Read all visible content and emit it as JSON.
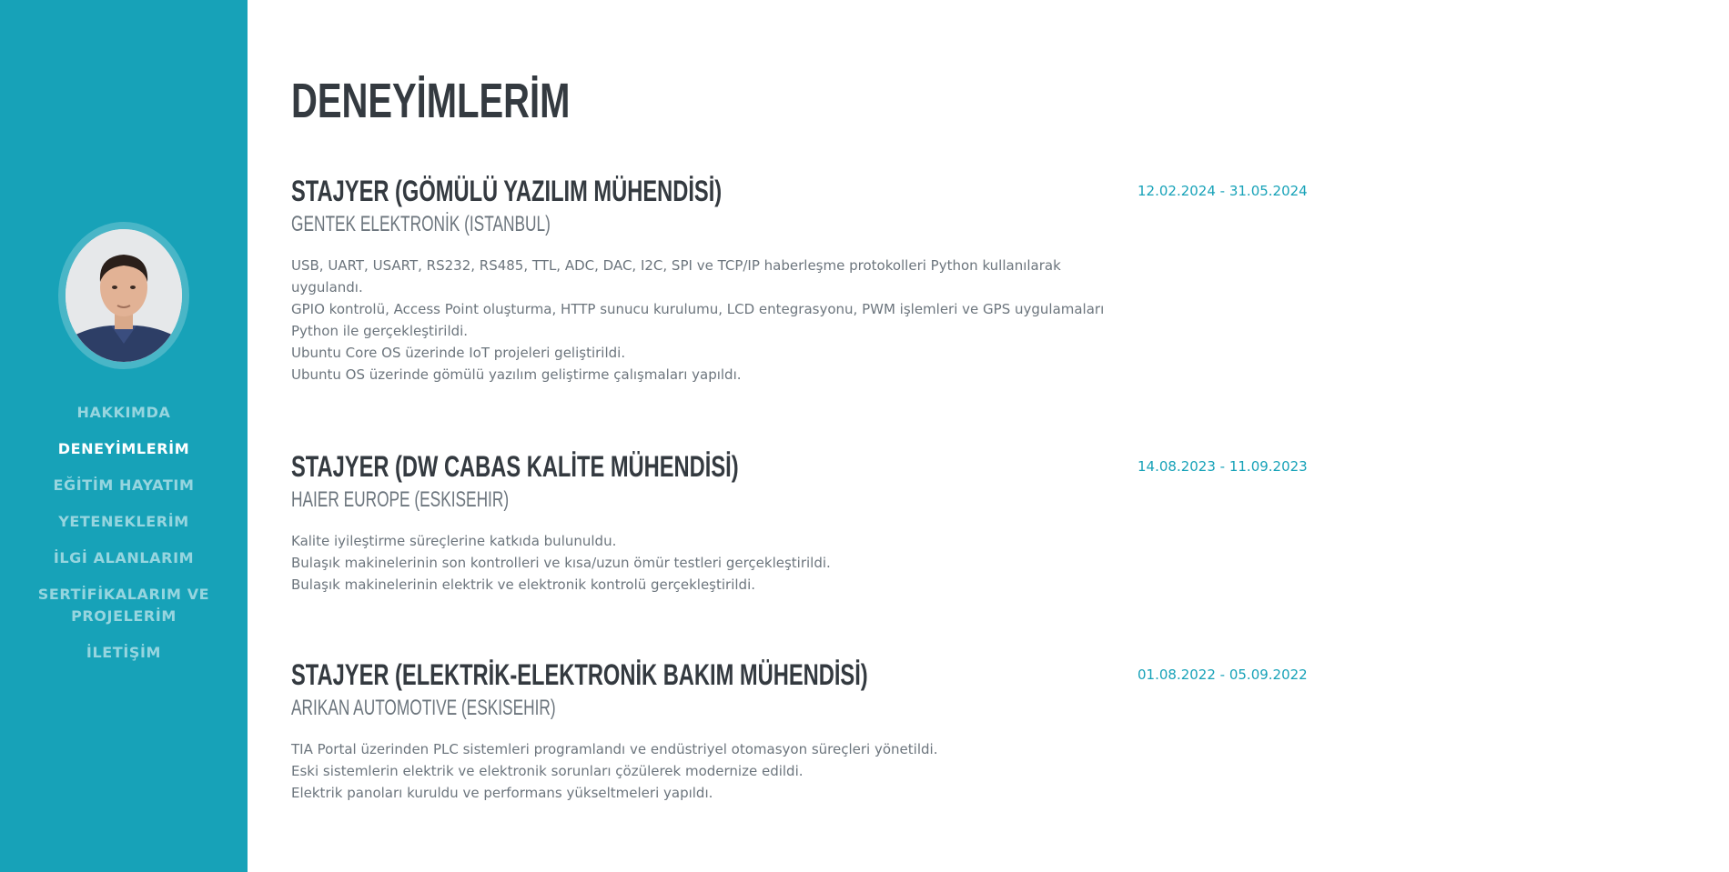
{
  "sidebar": {
    "nav": [
      {
        "label": "HAKKIMDA",
        "active": false
      },
      {
        "label": "DENEYİMLERİM",
        "active": true
      },
      {
        "label": "EĞİTİM HAYATIM",
        "active": false
      },
      {
        "label": "YETENEKLERİM",
        "active": false
      },
      {
        "label": "İLGİ ALANLARIM",
        "active": false
      },
      {
        "label": "SERTİFİKALARIM VE PROJELERİM",
        "active": false
      },
      {
        "label": "İLETİŞİM",
        "active": false
      }
    ],
    "accent_color": "#17a2b8"
  },
  "main": {
    "title": "DENEYİMLERİM",
    "experiences": [
      {
        "title": "STAJYER (GÖMÜLÜ YAZILIM MÜHENDİSİ)",
        "company": "GENTEK ELEKTRONİK (ISTANBUL)",
        "date": "12.02.2024 - 31.05.2024",
        "lines": [
          "USB, UART, USART, RS232, RS485, TTL, ADC, DAC, I2C, SPI ve TCP/IP haberleşme protokolleri Python kullanılarak uygulandı.",
          "GPIO kontrolü, Access Point oluşturma, HTTP sunucu kurulumu, LCD entegrasyonu, PWM işlemleri ve GPS uygulamaları Python ile gerçekleştirildi.",
          "Ubuntu Core OS üzerinde IoT projeleri geliştirildi.",
          "Ubuntu OS üzerinde gömülü yazılım geliştirme çalışmaları yapıldı."
        ]
      },
      {
        "title": "STAJYER (DW CABAS KALİTE MÜHENDİSİ)",
        "company": "HAIER EUROPE (ESKISEHIR)",
        "date": "14.08.2023 - 11.09.2023",
        "lines": [
          "Kalite iyileştirme süreçlerine katkıda bulunuldu.",
          "Bulaşık makinelerinin son kontrolleri ve kısa/uzun ömür testleri gerçekleştirildi.",
          "Bulaşık makinelerinin elektrik ve elektronik kontrolü gerçekleştirildi."
        ]
      },
      {
        "title": "STAJYER (ELEKTRİK-ELEKTRONİK BAKIM MÜHENDİSİ)",
        "company": "ARIKAN AUTOMOTIVE (ESKISEHIR)",
        "date": "01.08.2022 - 05.09.2022",
        "lines": [
          "TIA Portal üzerinden PLC sistemleri programlandı ve endüstriyel otomasyon süreçleri yönetildi.",
          "Eski sistemlerin elektrik ve elektronik sorunları çözülerek modernize edildi.",
          "Elektrik panoları kuruldu ve performans yükseltmeleri yapıldı."
        ]
      }
    ]
  }
}
